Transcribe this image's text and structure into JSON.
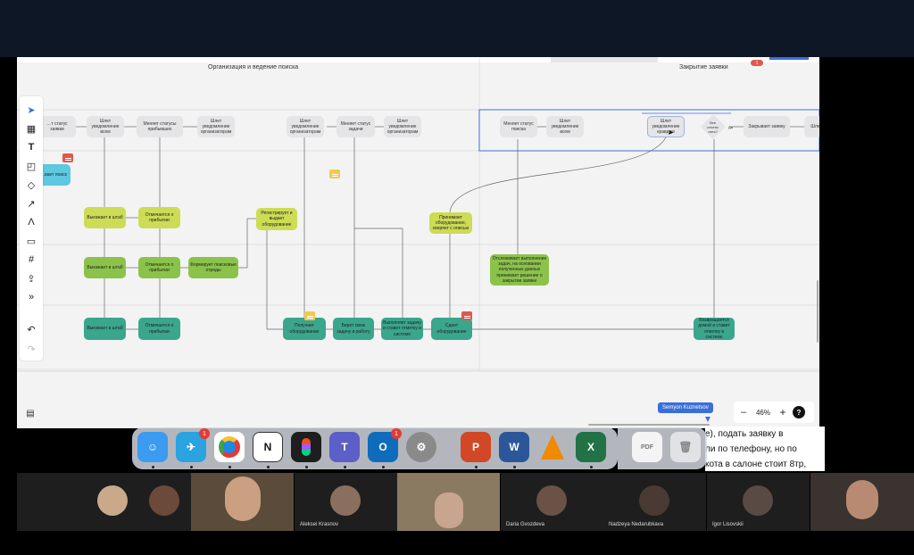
{
  "board": {
    "lanes": [
      {
        "title": "Организация и ведение поиска"
      },
      {
        "title": "Закрытие заявки"
      }
    ],
    "nodes": {
      "n1": "…т статус заявки",
      "n2": "Шлет уведомление всем",
      "n3": "Меняет статусы прибывших",
      "n4": "Шлет уведомление организаторам",
      "n5": "Шлет уведомление организаторам",
      "n6": "Меняет статус задачи",
      "n7": "Шлет уведомление организаторам",
      "n8": "Меняет статус поиска",
      "n9": "Шлет уведомление всем",
      "n10": "Шлет уведомление кравдам",
      "n11": "Все отчеты лить?",
      "n12": "Закрывает заявку",
      "n13": "Шле…",
      "n14": "…вает поиск",
      "n15": "Выезжает в штаб",
      "n16": "Отмечается о прибытии",
      "n17": "Регистрирует и выдает оборудование",
      "n18": "Принимает оборудование, сверяет с описью",
      "n19": "Выезжает в штаб",
      "n20": "Отмечается о прибытии",
      "n21": "Формирует поисковые отряды",
      "n22": "Отслеживает выполнение задач, на основании полученных данных принимает решение о закрытии заявки",
      "n23": "Выезжает в штаб",
      "n24": "Отмечается о прибытии",
      "n25": "Получает оборудование",
      "n26": "Берет свою задачу в работу",
      "n27": "Выполняет задачу и ставит отметку в системе",
      "n28": "Сдает оборудование",
      "n29": "Возвращается домой и ставит отметку в системе",
      "da": "Да"
    },
    "badge_count": "1",
    "cursor_user": "Semyon Kuznetsov",
    "zoom": {
      "minus": "–",
      "value": "46%",
      "plus": "+",
      "help": "?"
    }
  },
  "dock": {
    "apps": [
      {
        "name": "Finder"
      },
      {
        "name": "Telegram",
        "badge": "1"
      },
      {
        "name": "Chrome"
      },
      {
        "name": "Notion",
        "label": "N"
      },
      {
        "name": "Figma"
      },
      {
        "name": "Teams"
      },
      {
        "name": "Outlook",
        "badge": "1",
        "label": "O"
      },
      {
        "name": "System Settings"
      },
      {
        "name": "PowerPoint",
        "label": "P"
      },
      {
        "name": "Word",
        "label": "W"
      },
      {
        "name": "VLC"
      },
      {
        "name": "Excel",
        "label": "X"
      },
      {
        "name": "PDF",
        "label": "PDF"
      },
      {
        "name": "Trash"
      }
    ]
  },
  "document": {
    "lines": [
      "е), подать заявку в",
      "ли по телефону, но по",
      "кота в салоне стоит 8тр,"
    ]
  },
  "participants": [
    {
      "name": ""
    },
    {
      "name": ""
    },
    {
      "name": ""
    },
    {
      "name": "Aleksei Krasnov"
    },
    {
      "name": ""
    },
    {
      "name": "Daria Gvozdeva"
    },
    {
      "name": "Nadzeya Nedarubkava"
    },
    {
      "name": "Igor Lisovskii"
    },
    {
      "name": ""
    }
  ]
}
